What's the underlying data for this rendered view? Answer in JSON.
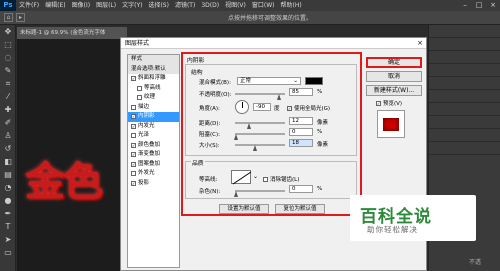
{
  "app": {
    "logo": "Ps",
    "menus": [
      "文件(F)",
      "编辑(E)",
      "图像(I)",
      "图层(L)",
      "文字(Y)",
      "选择(S)",
      "滤镜(T)",
      "3D(D)",
      "视图(V)",
      "窗口(W)",
      "帮助(H)"
    ],
    "win_min": "–",
    "win_max": "□",
    "win_close": "×"
  },
  "options": {
    "hint": "点按并拖移可调整效果的位置。"
  },
  "document": {
    "tab": "未标题-1 @ 69.9% (金色流光字体"
  },
  "canvas_text": "金色",
  "dialog": {
    "title": "图层样式",
    "close": "×",
    "styles_list": [
      {
        "label": "样式",
        "checkbox": false,
        "checked": false,
        "selected": false,
        "header": true,
        "sub": false
      },
      {
        "label": "混合选项:默认",
        "checkbox": false,
        "checked": false,
        "selected": false,
        "header": true,
        "sub": false
      },
      {
        "label": "斜面和浮雕",
        "checkbox": true,
        "checked": true,
        "selected": false,
        "header": false,
        "sub": false
      },
      {
        "label": "等高线",
        "checkbox": true,
        "checked": false,
        "selected": false,
        "header": false,
        "sub": true
      },
      {
        "label": "纹理",
        "checkbox": true,
        "checked": false,
        "selected": false,
        "header": false,
        "sub": true
      },
      {
        "label": "描边",
        "checkbox": true,
        "checked": false,
        "selected": false,
        "header": false,
        "sub": false
      },
      {
        "label": "内阴影",
        "checkbox": true,
        "checked": true,
        "selected": true,
        "header": false,
        "sub": false
      },
      {
        "label": "内发光",
        "checkbox": true,
        "checked": true,
        "selected": false,
        "header": false,
        "sub": false
      },
      {
        "label": "光泽",
        "checkbox": true,
        "checked": false,
        "selected": false,
        "header": false,
        "sub": false
      },
      {
        "label": "颜色叠加",
        "checkbox": true,
        "checked": true,
        "selected": false,
        "header": false,
        "sub": false
      },
      {
        "label": "渐变叠加",
        "checkbox": true,
        "checked": true,
        "selected": false,
        "header": false,
        "sub": false
      },
      {
        "label": "图案叠加",
        "checkbox": true,
        "checked": true,
        "selected": false,
        "header": false,
        "sub": false
      },
      {
        "label": "外发光",
        "checkbox": true,
        "checked": false,
        "selected": false,
        "header": false,
        "sub": false
      },
      {
        "label": "投影",
        "checkbox": true,
        "checked": true,
        "selected": false,
        "header": false,
        "sub": false
      }
    ],
    "section_title": "内阴影",
    "structure": {
      "title": "结构",
      "blend_label": "混合模式(B):",
      "blend_value": "正常",
      "blend_color": "#000000",
      "opacity_label": "不透明度(O):",
      "opacity_value": "85",
      "opacity_unit": "%",
      "angle_label": "角度(A):",
      "angle_value": "-90",
      "angle_unit": "度",
      "global_light_label": "使用全局光(G)",
      "global_light_checked": true,
      "distance_label": "距离(D):",
      "distance_value": "12",
      "distance_unit": "像素",
      "choke_label": "阻塞(C):",
      "choke_value": "0",
      "choke_unit": "%",
      "size_label": "大小(S):",
      "size_value": "18",
      "size_unit": "像素"
    },
    "quality": {
      "title": "品质",
      "contour_label": "等高线:",
      "antialias_label": "消除锯齿(L)",
      "antialias_checked": false,
      "noise_label": "杂色(N):",
      "noise_value": "0",
      "noise_unit": "%"
    },
    "buttons": {
      "set_default": "设置为默认值",
      "reset_default": "复位为默认值",
      "ok": "确定",
      "cancel": "取消",
      "new_style": "新建样式(W)...",
      "preview": "预览(V)",
      "preview_checked": true
    }
  },
  "watermark": {
    "title": "百科全说",
    "subtitle": "助你轻松解决"
  },
  "right_panel": {
    "label": "不透"
  },
  "colors": {
    "accent_red": "#e01a1a",
    "selected_blue": "#3399ff",
    "watermark_green": "#2d8a3b"
  }
}
